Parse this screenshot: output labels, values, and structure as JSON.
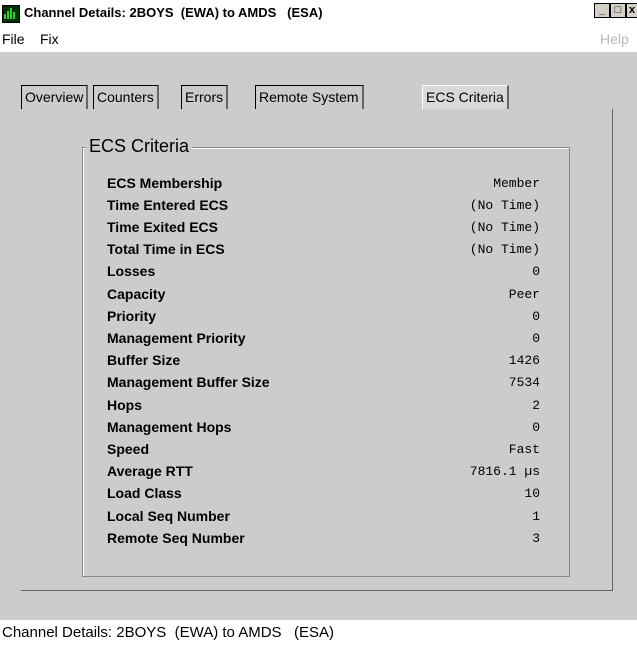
{
  "window": {
    "title": "Channel Details: 2BOYS  (EWA) to AMDS   (ESA)",
    "icon": "bar-chart-icon",
    "buttons": {
      "minimize": "_",
      "maximize": "□",
      "close": "x"
    }
  },
  "menubar": {
    "items": [
      {
        "label": "File"
      },
      {
        "label": "Fix"
      }
    ],
    "help": "Help"
  },
  "tabs": [
    {
      "label": "Overview",
      "active": false
    },
    {
      "label": "Counters",
      "active": false
    },
    {
      "label": "Errors",
      "active": false
    },
    {
      "label": "Remote System",
      "active": false
    },
    {
      "label": "ECS Criteria",
      "active": true
    }
  ],
  "group": {
    "title": "ECS Criteria",
    "rows": [
      {
        "label": "ECS Membership",
        "value": "Member"
      },
      {
        "label": "Time Entered ECS",
        "value": "(No Time)"
      },
      {
        "label": "Time Exited ECS",
        "value": "(No Time)"
      },
      {
        "label": "Total Time in ECS",
        "value": "(No Time)"
      },
      {
        "label": "Losses",
        "value": "0"
      },
      {
        "label": "Capacity",
        "value": "Peer"
      },
      {
        "label": "Priority",
        "value": "0"
      },
      {
        "label": "Management Priority",
        "value": "0"
      },
      {
        "label": "Buffer Size",
        "value": "1426"
      },
      {
        "label": "Management Buffer Size",
        "value": "7534"
      },
      {
        "label": "Hops",
        "value": "2"
      },
      {
        "label": "Management Hops",
        "value": "0"
      },
      {
        "label": "Speed",
        "value": "Fast"
      },
      {
        "label": "Average RTT",
        "value": "7816.1 µs"
      },
      {
        "label": "Load Class",
        "value": "10"
      },
      {
        "label": "Local Seq Number",
        "value": "1"
      },
      {
        "label": "Remote Seq Number",
        "value": "3"
      }
    ]
  },
  "statusbar": {
    "text": "Channel Details: 2BOYS  (EWA) to AMDS   (ESA)"
  },
  "colors": {
    "background": "#cccccc",
    "chrome": "#ffffff",
    "icon_bg": "#003300",
    "icon_bars": "#33cc33",
    "disabled_text": "#b8b8b8"
  }
}
